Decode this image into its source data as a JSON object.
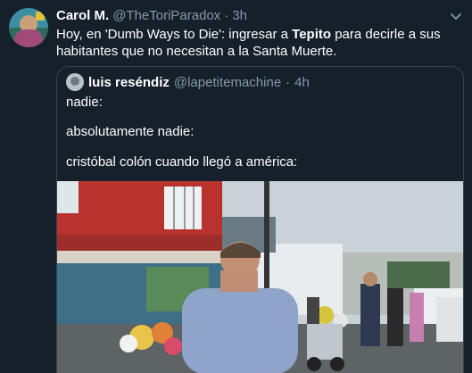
{
  "tweet": {
    "author_name": "Carol M.",
    "handle": "@TheToriParadox",
    "separator": "·",
    "time": "3h",
    "text_parts": [
      "Hoy, en 'Dumb Ways to Die':  ingresar a ",
      "Tepito",
      " para decirle a sus habitantes que no necesitan a la Santa Muerte."
    ]
  },
  "quote": {
    "author_name": "luis reséndiz",
    "handle": "@lapetitemachine",
    "separator": "·",
    "time": "4h",
    "lines": [
      "nadie:",
      "absolutamente nadie:",
      "cristóbal colón cuando llegó a américa:"
    ]
  },
  "icons": [
    "chevron-down-icon"
  ],
  "colors": {
    "background": "#15202b",
    "secondary_text": "#8899a6",
    "border": "#38444d"
  }
}
